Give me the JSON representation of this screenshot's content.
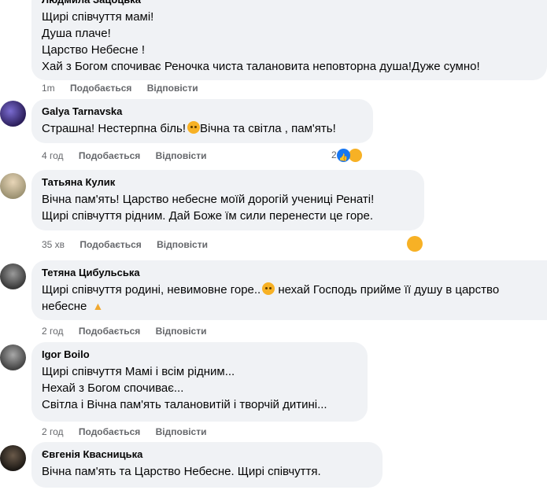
{
  "comments": [
    {
      "author": "Людмила Зацоцька",
      "lines": [
        "Щирі співчуття мамі!",
        "Душа плаче!",
        "Царство Небесне !",
        "Хай з Богом спочиває Реночка чиста талановита неповторна душа!Дуже сумно!"
      ],
      "time": "1m",
      "like_label": "Подобається",
      "reply_label": "Відповісти"
    },
    {
      "author": "Galya Tarnavska",
      "lines": [
        "Страшна! Нестерпна біль!",
        "Вічна та світла , пам'ять!"
      ],
      "time": "4 год",
      "like_label": "Подобається",
      "reply_label": "Відповісти",
      "reaction_count": "2"
    },
    {
      "author": "Татьяна Кулик",
      "lines": [
        "Вічна пам'ять! Царство небесне моїй дорогій учениці Ренаті!",
        "Щирі співчуття рідним. Дай Боже їм сили перенести це горе."
      ],
      "time": "35 хв",
      "like_label": "Подобається",
      "reply_label": "Відповісти"
    },
    {
      "author": "Тетяна Цибульська",
      "lines": [
        "Щирі співчуття родині, невимовне горе..",
        "нехай Господь прийме її душу в царство",
        "небесне"
      ],
      "time": "2 год",
      "like_label": "Подобається",
      "reply_label": "Відповісти"
    },
    {
      "author": "Igor Boilo",
      "lines": [
        "Щирі співчуття Мамі і всім рідним...",
        "Нехай з Богом спочиває...",
        "Світла і Вічна пам'ять талановитій і творчій дитині..."
      ],
      "time": "2 год",
      "like_label": "Подобається",
      "reply_label": "Відповісти"
    },
    {
      "author": "Євгенія Квасницька",
      "lines": [
        "Вічна пам'ять та Царство Небесне. Щирі співчуття."
      ],
      "time": "",
      "like_label": "",
      "reply_label": ""
    }
  ],
  "icons": {
    "sad_emoji": "sad-face-icon",
    "teary_emoji": "teary-face-icon",
    "pray_emoji": "praying-hands-icon",
    "like_reaction": "like-reaction-icon"
  },
  "colors": {
    "bubble": "#f0f2f5",
    "meta_text": "#65676b",
    "like_blue": "#1877f2",
    "emoji_yellow": "#f7b125"
  }
}
